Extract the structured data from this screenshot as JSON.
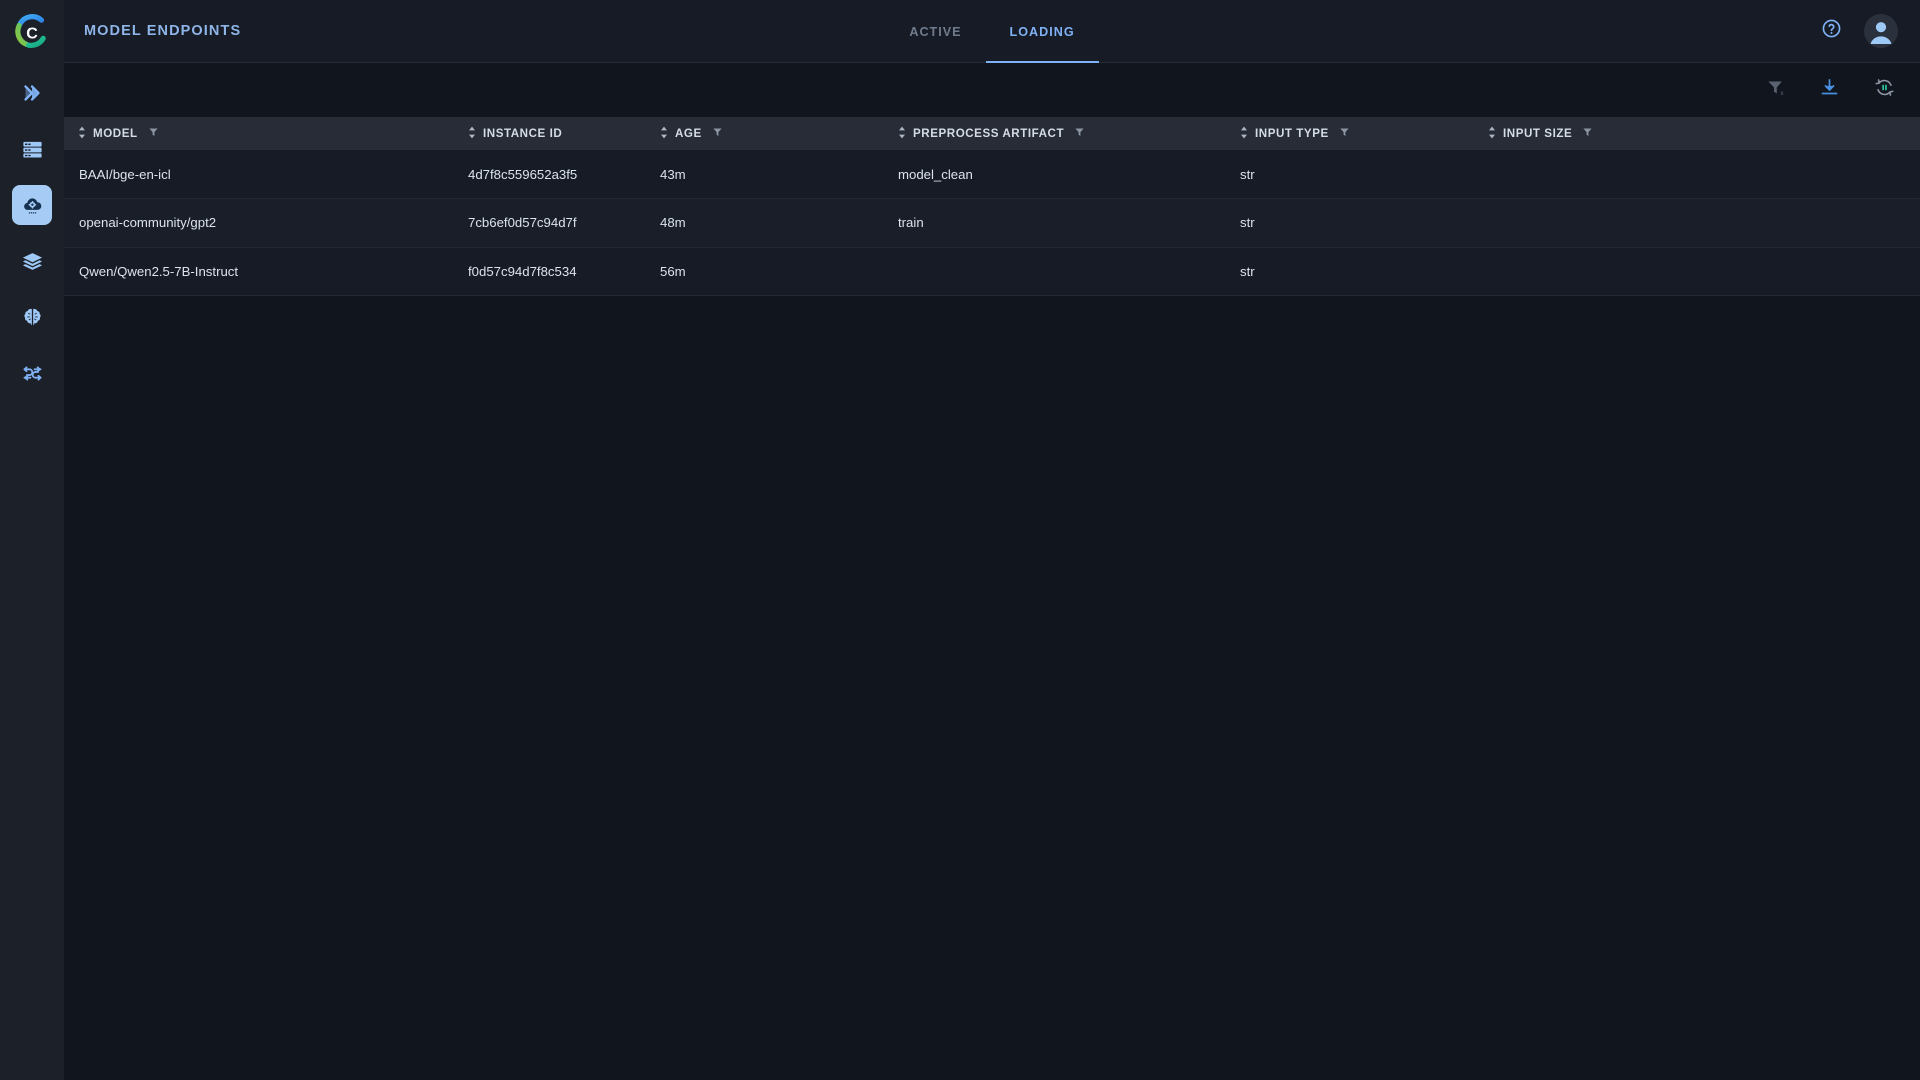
{
  "app": {
    "logo_name": "cnvrg-logo"
  },
  "sidebar": {
    "items": [
      {
        "name": "sidebar-item-experiments",
        "icon": "double-chevron-right-icon",
        "label": "Experiments",
        "active": false
      },
      {
        "name": "sidebar-item-datasets",
        "icon": "server-rack-icon",
        "label": "Datasets",
        "active": false
      },
      {
        "name": "sidebar-item-model-endpoints",
        "icon": "cloud-gear-icon",
        "label": "Model Endpoints",
        "active": true
      },
      {
        "name": "sidebar-item-layers",
        "icon": "layers-stack-icon",
        "label": "Layers",
        "active": false
      },
      {
        "name": "sidebar-item-ai-library",
        "icon": "brain-icon",
        "label": "AI Library",
        "active": false
      },
      {
        "name": "sidebar-item-flows",
        "icon": "pipeline-flow-icon",
        "label": "Flows",
        "active": false
      }
    ]
  },
  "header": {
    "title": "MODEL ENDPOINTS",
    "tabs": [
      {
        "label": "ACTIVE",
        "name": "tab-active",
        "active": false
      },
      {
        "label": "LOADING",
        "name": "tab-loading",
        "active": true
      }
    ],
    "help_icon": "question-circle-icon",
    "avatar_icon": "user-avatar-icon"
  },
  "toolbar": {
    "actions": [
      {
        "name": "clear-filters-button",
        "icon": "filter-clear-icon",
        "enabled": false
      },
      {
        "name": "download-button",
        "icon": "download-icon",
        "enabled": true
      },
      {
        "name": "auto-refresh-pause-button",
        "icon": "refresh-pause-icon",
        "enabled": true
      }
    ]
  },
  "table": {
    "columns": [
      {
        "label": "MODEL",
        "sortable": true,
        "filterable": true,
        "name": "column-model"
      },
      {
        "label": "INSTANCE ID",
        "sortable": true,
        "filterable": false,
        "name": "column-instance-id"
      },
      {
        "label": "AGE",
        "sortable": true,
        "filterable": true,
        "name": "column-age"
      },
      {
        "label": "PREPROCESS ARTIFACT",
        "sortable": true,
        "filterable": true,
        "name": "column-preprocess-artifact"
      },
      {
        "label": "INPUT TYPE",
        "sortable": true,
        "filterable": true,
        "name": "column-input-type"
      },
      {
        "label": "INPUT SIZE",
        "sortable": true,
        "filterable": true,
        "name": "column-input-size"
      }
    ],
    "rows": [
      {
        "model": "BAAI/bge-en-icl",
        "instance_id": "4d7f8c559652a3f5",
        "age": "43m",
        "preprocess_artifact": "model_clean",
        "input_type": "str",
        "input_size": ""
      },
      {
        "model": "openai-community/gpt2",
        "instance_id": "7cb6ef0d57c94d7f",
        "age": "48m",
        "preprocess_artifact": "train",
        "input_type": "str",
        "input_size": ""
      },
      {
        "model": "Qwen/Qwen2.5-7B-Instruct",
        "instance_id": "f0d57c94d7f8c534",
        "age": "56m",
        "preprocess_artifact": "",
        "input_type": "str",
        "input_size": ""
      }
    ]
  },
  "colors": {
    "background": "#11151d",
    "sidebar": "#1c2029",
    "topbar": "#161b25",
    "accent": "#7fb2f5",
    "table_header": "#272c36",
    "row_odd": "#171b25",
    "row_even": "#191e28",
    "active_nav": "#a6ccf5",
    "muted_text": "#707c8e"
  }
}
